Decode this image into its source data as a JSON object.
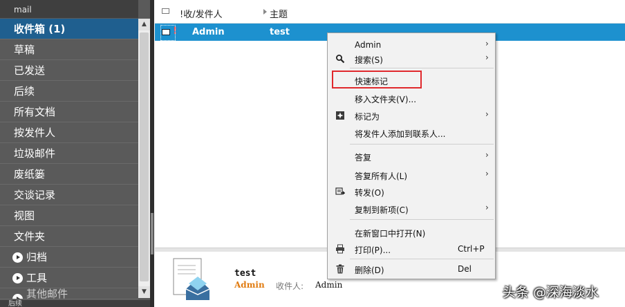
{
  "sidebar": {
    "title": "mail",
    "items": [
      {
        "label": "收件箱 (1)"
      },
      {
        "label": "草稿"
      },
      {
        "label": "已发送"
      },
      {
        "label": "后续"
      },
      {
        "label": "所有文档"
      },
      {
        "label": "按发件人"
      },
      {
        "label": "垃圾邮件"
      },
      {
        "label": "废纸篓"
      },
      {
        "label": "交谈记录"
      },
      {
        "label": "视图"
      },
      {
        "label": "文件夹"
      },
      {
        "label": "归档"
      },
      {
        "label": "工具"
      },
      {
        "label": "其他邮件"
      }
    ],
    "bottom_label": "后续"
  },
  "list": {
    "col_sender": "!收/发件人",
    "col_subject": "主题",
    "row": {
      "priority": "!",
      "sender": "Admin",
      "subject": "test"
    }
  },
  "preview": {
    "subject": "test",
    "from": "Admin",
    "to_label": "收件人:",
    "to": "Admin"
  },
  "context_menu": {
    "items": [
      {
        "label": "Admin",
        "submenu": true
      },
      {
        "label": "搜索(S)",
        "submenu": true,
        "icon": "search-icon"
      },
      {
        "label": "快速标记"
      },
      {
        "label": "移入文件夹(V)..."
      },
      {
        "label": "标记为",
        "submenu": true,
        "icon": "mark-icon"
      },
      {
        "label": "将发件人添加到联系人..."
      },
      {
        "label": "答复",
        "submenu": true
      },
      {
        "label": "答复所有人(L)",
        "submenu": true
      },
      {
        "label": "转发(O)",
        "icon": "forward-icon"
      },
      {
        "label": "复制到新项(C)",
        "submenu": true
      },
      {
        "label": "在新窗口中打开(N)"
      },
      {
        "label": "打印(P)...",
        "shortcut": "Ctrl+P",
        "icon": "printer-icon"
      },
      {
        "label": "删除(D)",
        "shortcut": "Del",
        "icon": "trash-icon"
      }
    ]
  },
  "watermark": "头条 @深海淡水",
  "colors": {
    "sidebar_bg": "#5a5a5a",
    "selected_nav": "#1f5f8f",
    "selected_row": "#1d91cf",
    "highlight_box": "#e0282c",
    "sender_accent": "#e07b10"
  }
}
